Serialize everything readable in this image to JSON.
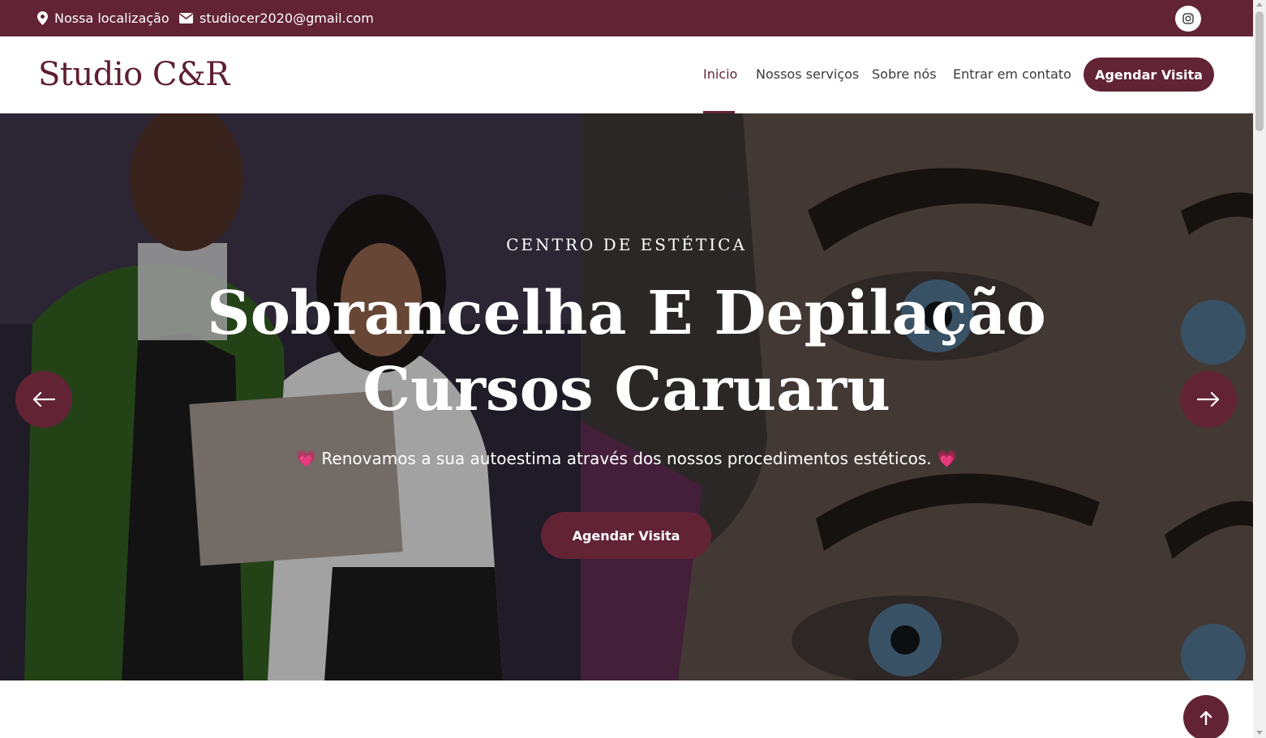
{
  "topbar": {
    "location": "Nossa localização",
    "email": "studiocer2020@gmail.com",
    "social_icon": "instagram-icon"
  },
  "header": {
    "logo": "Studio C&R",
    "nav": [
      {
        "label": "Inicio",
        "active": true
      },
      {
        "label": "Nossos serviços",
        "active": false
      },
      {
        "label": "Sobre nós",
        "active": false
      },
      {
        "label": "Entrar em contato",
        "active": false
      }
    ],
    "cta_label": "Agendar Visita"
  },
  "hero": {
    "kicker": "CENTRO DE ESTÉTICA",
    "title_line1": "Sobrancelha E Depilação",
    "title_line2": "Cursos Caruaru",
    "subtitle": "Renovamos a sua autoestima através dos nossos procedimentos estéticos.",
    "heart": "💗",
    "cta_label": "Agendar Visita"
  },
  "colors": {
    "brand": "#622335",
    "white": "#ffffff"
  }
}
